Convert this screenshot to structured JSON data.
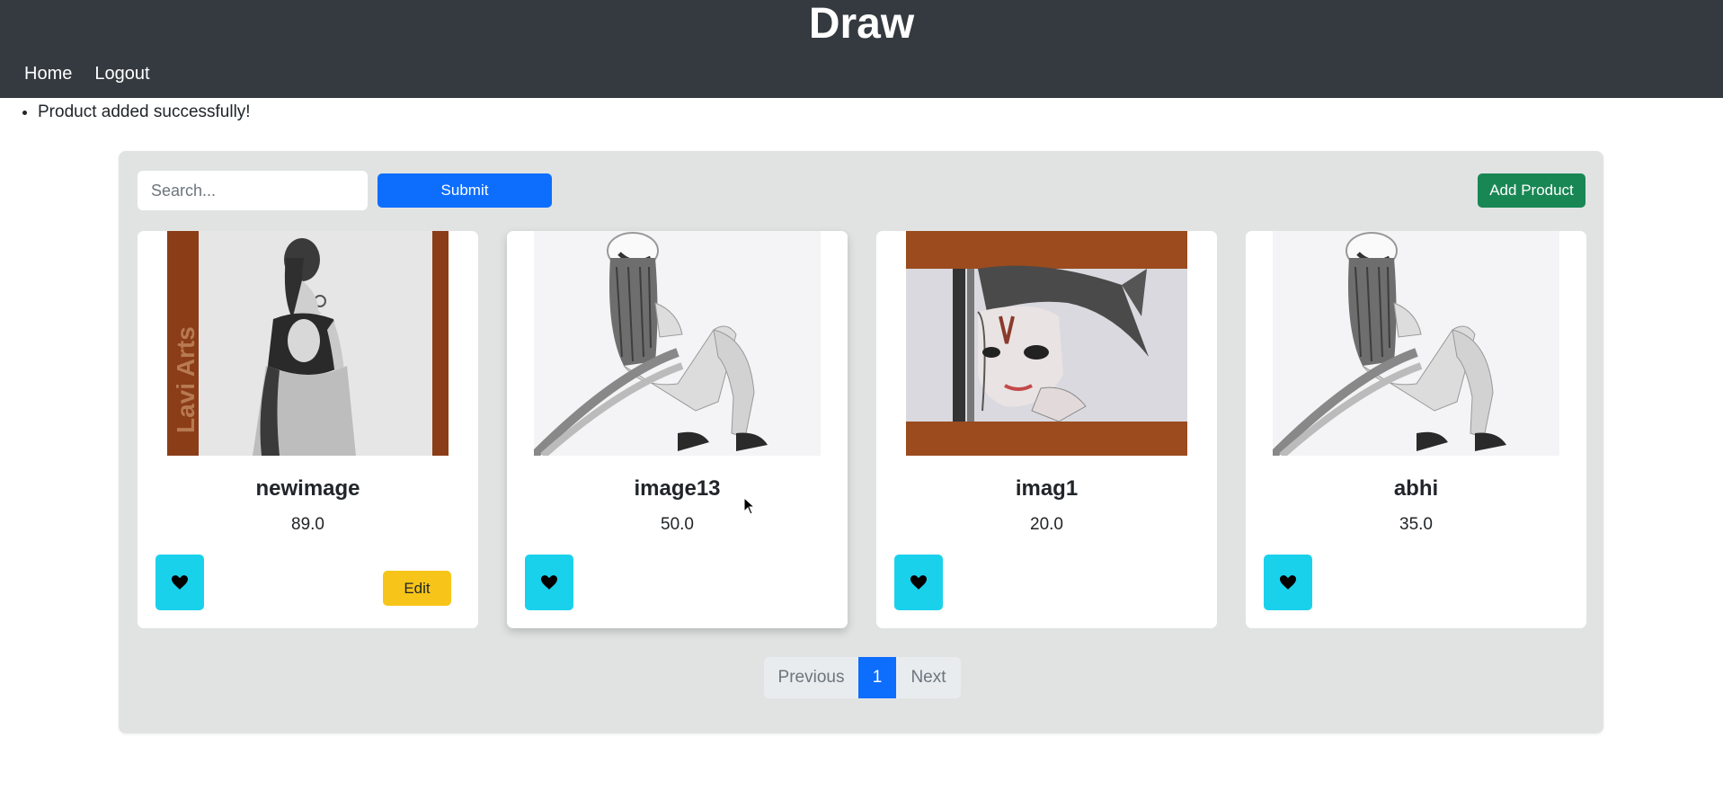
{
  "header": {
    "title": "Draw",
    "nav": [
      {
        "label": "Home"
      },
      {
        "label": "Logout"
      }
    ]
  },
  "messages": [
    "Product added successfully!"
  ],
  "toolbar": {
    "search_placeholder": "Search...",
    "search_value": "",
    "submit_label": "Submit",
    "add_product_label": "Add Product"
  },
  "products": [
    {
      "name": "newimage",
      "price": "89.0",
      "edit_label": "Edit",
      "image": "woman-back-sketch-lavi-arts"
    },
    {
      "name": "image13",
      "price": "50.0",
      "image": "girl-cap-sitting-sketch"
    },
    {
      "name": "imag1",
      "price": "20.0",
      "image": "krishna-half-face-sketch"
    },
    {
      "name": "abhi",
      "price": "35.0",
      "image": "girl-cap-sitting-sketch"
    }
  ],
  "thumb_watermark": "Lavi Arts",
  "pagination": {
    "previous_label": "Previous",
    "current_page": "1",
    "next_label": "Next"
  },
  "colors": {
    "header_bg": "#343a40",
    "panel_bg": "#e1e3e3",
    "primary": "#0d6efd",
    "success": "#198754",
    "like": "#1ad1ec",
    "edit": "#f7c51a"
  }
}
